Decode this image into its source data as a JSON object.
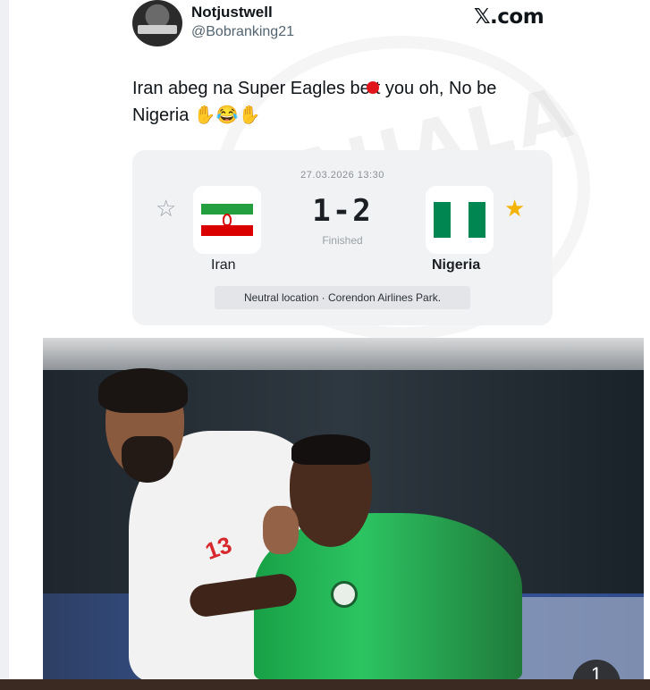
{
  "tweet": {
    "display_name": "Notjustwell",
    "handle": "@Bobranking21",
    "source_label": "𝕏.com",
    "text_before_dot": "Iran abeg na Super Eagles be",
    "text_after_dot": "t you oh, No be",
    "text_line2": "Nigeria",
    "emoji": "✋😂✋"
  },
  "watermark": {
    "text": "WAHALA NEWS"
  },
  "match": {
    "datetime": "27.03.2026 13:30",
    "home_team": "Iran",
    "away_team": "Nigeria",
    "score": "1-2",
    "status": "Finished",
    "venue": "Neutral location · Corendon Airlines Park.",
    "home_star": "☆",
    "away_star": "★"
  },
  "photo": {
    "jersey_number": "13",
    "carousel_label": "1"
  },
  "colors": {
    "accent_star": "#f5b301",
    "iran_green": "#239f40",
    "iran_red": "#da0000",
    "nigeria_green": "#008751"
  }
}
